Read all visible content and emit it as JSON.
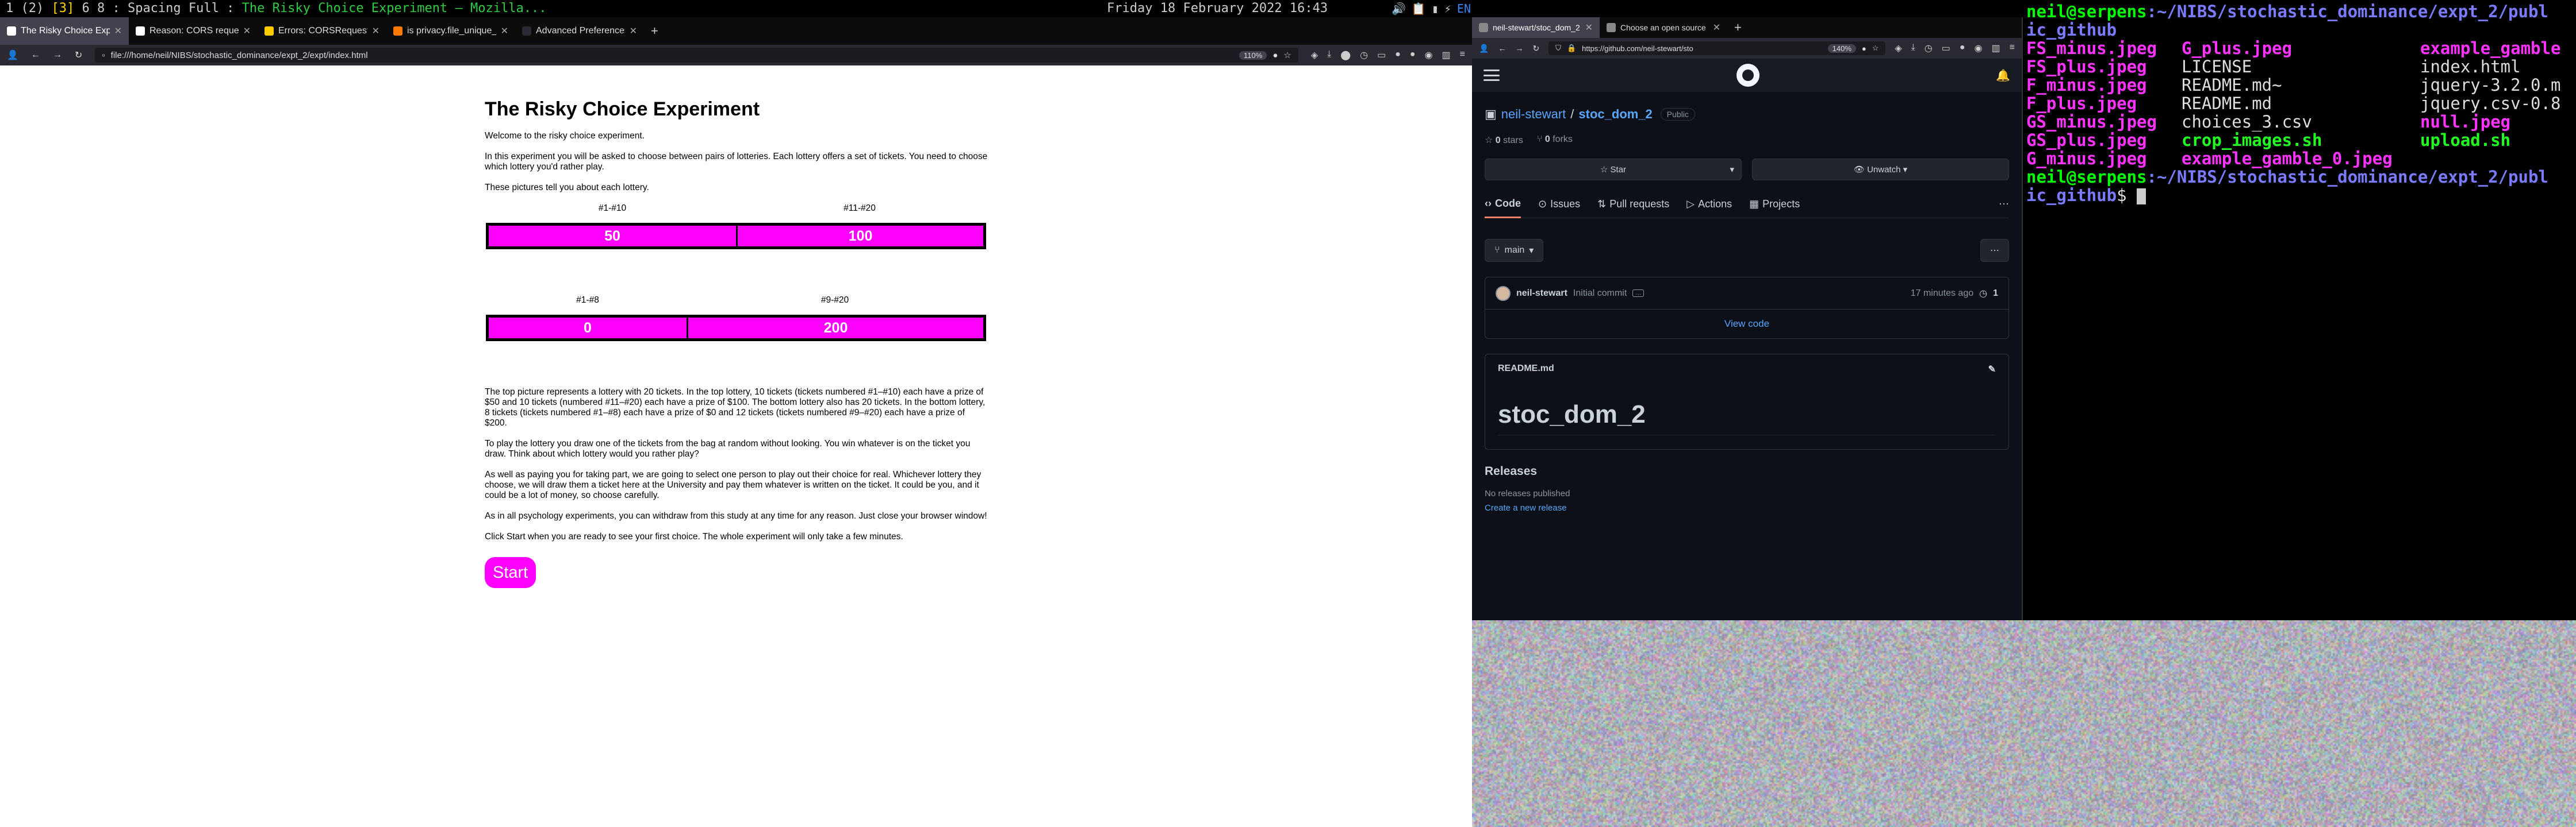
{
  "topbar": {
    "workspaces": "1 (2) ",
    "current_ws": "[3]",
    "ws_rest": " 6 8 : Spacing Full : ",
    "window_title": "The Risky Choice Experiment — Mozilla...",
    "clock": "Friday 18 February 2022  16:43",
    "lang": "EN"
  },
  "left_browser": {
    "tabs": [
      {
        "label": "The Risky Choice Experim",
        "favicon_color": "#ffffff",
        "active": true
      },
      {
        "label": "Reason: CORS request n",
        "favicon_color": "#ffffff",
        "active": false
      },
      {
        "label": "Errors: CORSRequestN",
        "favicon_color": "#ffcc00",
        "active": false
      },
      {
        "label": "is privacy.file_unique_o",
        "favicon_color": "#ff7a00",
        "active": false
      },
      {
        "label": "Advanced Preferences",
        "favicon_color": "#2b2a33",
        "active": false
      }
    ],
    "url": "file:///home/neil/NIBS/stochastic_dominance/expt_2/expt/index.html",
    "zoom": "110%"
  },
  "page": {
    "title": "The Risky Choice Experiment",
    "p1": "Welcome to the risky choice experiment.",
    "p2": "In this experiment you will be asked to choose between pairs of lotteries. Each lottery offers a set of tickets. You need to choose which lottery you'd rather play.",
    "p3": "These pictures tell you about each lottery.",
    "lottery_top": {
      "segments": [
        {
          "label": "#1-#10",
          "prize": "50",
          "tickets": 10
        },
        {
          "label": "#11-#20",
          "prize": "100",
          "tickets": 10
        }
      ]
    },
    "lottery_bottom": {
      "segments": [
        {
          "label": "#1-#8",
          "prize": "0",
          "tickets": 8
        },
        {
          "label": "#9-#20",
          "prize": "200",
          "tickets": 12
        }
      ]
    },
    "p4": "The top picture represents a lottery with 20 tickets. In the top lottery, 10 tickets (tickets numbered #1–#10) each have a prize of $50 and 10 tickets (numbered #11–#20) each have a prize of $100. The bottom lottery also has 20 tickets. In the bottom lottery, 8 tickets (tickets numbered #1–#8) each have a prize of $0 and 12 tickets (tickets numbered #9–#20) each have a prize of $200.",
    "p5": "To play the lottery you draw one of the tickets from the bag at random without looking. You win whatever is on the ticket you draw. Think about which lottery would you rather play?",
    "p6": "As well as paying you for taking part, we are going to select one person to play out their choice for real. Whichever lottery they choose, we will draw them a ticket here at the University and pay them whatever is written on the ticket. It could be you, and it could be a lot of money, so choose carefully.",
    "p7": "As in all psychology experiments, you can withdraw from this study at any time for any reason. Just close your browser window!",
    "p8": "Click Start when you are ready to see your first choice. The whole experiment will only take a few minutes.",
    "start": "Start",
    "accent": "#ff00ff"
  },
  "right_browser": {
    "tabs": [
      {
        "label": "neil-stewart/stoc_dom_2",
        "active": true
      },
      {
        "label": "Choose an open source l",
        "active": false
      }
    ],
    "url": "https://github.com/neil-stewart/sto",
    "zoom": "140%"
  },
  "github": {
    "owner": "neil-stewart",
    "sep": "/",
    "repo": "stoc_dom_2",
    "visibility": "Public",
    "stars": "0",
    "stars_label": "stars",
    "forks": "0",
    "forks_label": "forks",
    "star_btn": "Star",
    "watch_btn": "Unwatch",
    "tabs": [
      "Code",
      "Issues",
      "Pull requests",
      "Actions",
      "Projects"
    ],
    "branch": "main",
    "commit_user": "neil-stewart",
    "commit_msg": "Initial commit",
    "commit_time": "17 minutes ago",
    "commit_count": "1",
    "view_code": "View code",
    "readme_file": "README.md",
    "readme_title": "stoc_dom_2",
    "releases": "Releases",
    "no_releases": "No releases published",
    "create_release": "Create a new release"
  },
  "terminal": {
    "prompt": "neil@serpens",
    "path1": ":~/NIBS/stochastic_dominance/expt_2/publ",
    "path1b": "ic_github",
    "ls_rows": [
      [
        {
          "t": "FS_minus.jpeg",
          "c": "mag"
        },
        {
          "t": "G_plus.jpeg",
          "c": "mag"
        },
        {
          "t": "example_gamble",
          "c": "mag"
        }
      ],
      [
        {
          "t": "FS_plus.jpeg",
          "c": "mag"
        },
        {
          "t": "LICENSE",
          "c": "plain"
        },
        {
          "t": "index.html",
          "c": "plain"
        }
      ],
      [
        {
          "t": "F_minus.jpeg",
          "c": "mag"
        },
        {
          "t": "README.md~",
          "c": "plain"
        },
        {
          "t": "jquery-3.2.0.m",
          "c": "plain"
        }
      ],
      [
        {
          "t": "F_plus.jpeg",
          "c": "mag"
        },
        {
          "t": "README.md",
          "c": "plain"
        },
        {
          "t": "jquery.csv-0.8",
          "c": "plain"
        }
      ],
      [
        {
          "t": "GS_minus.jpeg",
          "c": "mag"
        },
        {
          "t": "choices_3.csv",
          "c": "plain"
        },
        {
          "t": "null.jpeg",
          "c": "mag"
        }
      ],
      [
        {
          "t": "GS_plus.jpeg",
          "c": "mag"
        },
        {
          "t": "crop_images.sh",
          "c": "grn"
        },
        {
          "t": "upload.sh",
          "c": "grn"
        }
      ],
      [
        {
          "t": "G_minus.jpeg",
          "c": "mag"
        },
        {
          "t": "example_gamble_0.jpeg",
          "c": "mag"
        },
        {
          "t": "",
          "c": "plain"
        }
      ]
    ],
    "prompt2": "neil@serpens",
    "path2": ":~/NIBS/stochastic_dominance/expt_2/publ",
    "path2b": "ic_github",
    "dollar": "$ "
  }
}
